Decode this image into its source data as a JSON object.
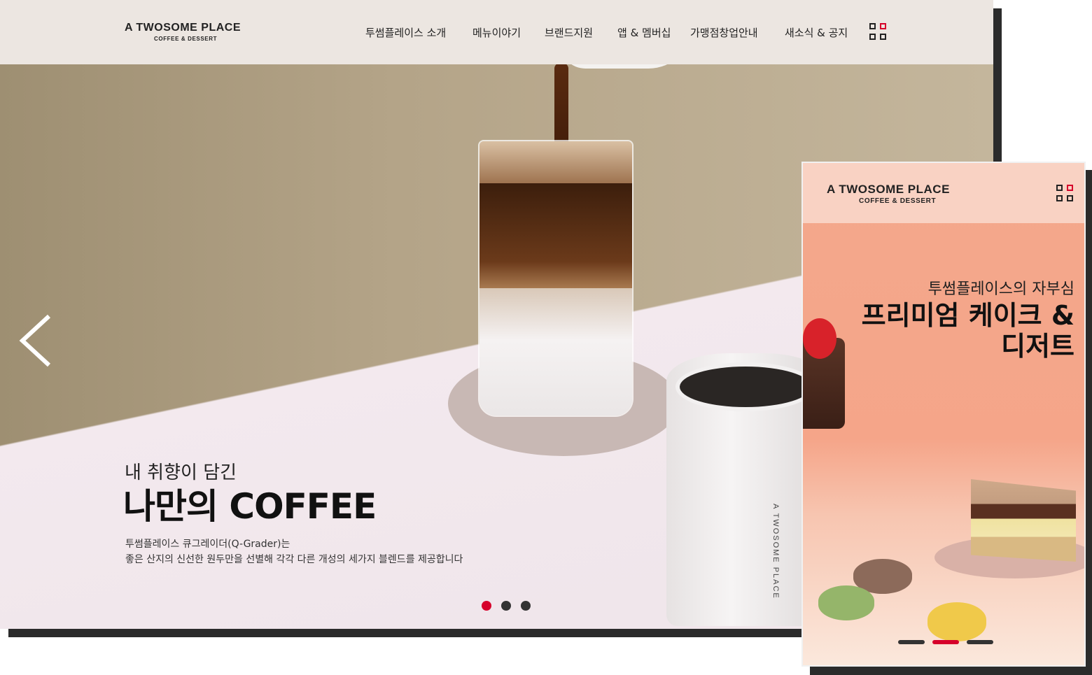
{
  "desktop": {
    "logo": {
      "main": "A TWOSOME PLACE",
      "sub": "COFFEE & DESSERT"
    },
    "nav": [
      "투썸플레이스 소개",
      "메뉴이야기",
      "브랜드지원",
      "앱 & 멤버십",
      "가맹점창업안내",
      "새소식 & 공지"
    ],
    "hero": {
      "small_heading": "내 취향이 담긴",
      "big_heading": "나만의 COFFEE",
      "desc_line1": "투썸플레이스 큐그레이더(Q-Grader)는",
      "desc_line2": "좋은 산지의 신선한 원두만을 선별해 각각 다른 개성의 세가지 블렌드를 제공합니다",
      "cup_brand": "A TWOSOME PLACE"
    },
    "slider": {
      "count": 3,
      "active": 1,
      "active_color": "#d6002a"
    }
  },
  "mobile": {
    "logo": {
      "main": "A TWOSOME PLACE",
      "sub": "COFFEE & DESSERT"
    },
    "sub_heading": "투썸플레이스의 자부심",
    "title_line1": "프리미엄 케이크 &",
    "title_line2": "디저트",
    "slider": {
      "count": 3,
      "active": 2,
      "active_color": "#d6002a"
    }
  },
  "colors": {
    "header_bg": "#ece6e1",
    "accent": "#d6002a",
    "mobile_header_bg": "#f9d2c3"
  }
}
